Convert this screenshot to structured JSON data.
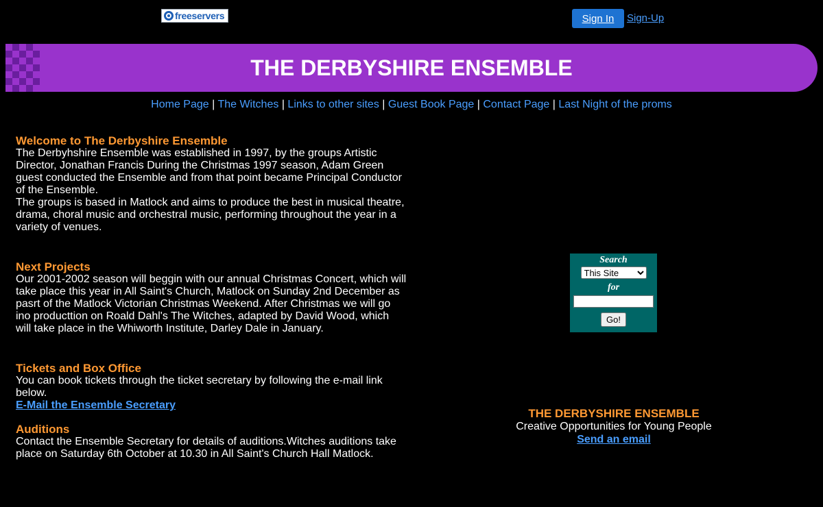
{
  "header": {
    "logo_text": "freeservers",
    "signin_label": "Sign In",
    "signup_label": "Sign-Up"
  },
  "banner": {
    "title": "THE DERBYSHIRE ENSEMBLE"
  },
  "nav": {
    "items": [
      "Home Page",
      "The Witches",
      "Links to other sites",
      "Guest Book Page",
      "Contact Page",
      "Last Night of the proms"
    ],
    "separator": "|"
  },
  "sections": {
    "welcome": {
      "heading": "Welcome to The Derbyshire Ensemble",
      "para1": "The Derbyhshire Ensemble was established in 1997, by the groups Artistic Director, Jonathan Francis During the Christmas 1997 season, Adam Green guest conducted the Ensemble and from that point became Principal Conductor of the Ensemble.",
      "para2": "The groups is based in Matlock and aims to produce the best in musical theatre, drama, choral music and orchestral music, performing throughout the year in a variety of venues."
    },
    "next_projects": {
      "heading": "Next Projects",
      "para": "Our 2001-2002 season will beggin with our annual Christmas Concert, which will take place this year in All Saint's Church, Matlock on Sunday 2nd December as pasrt of the Matlock Victorian Christmas Weekend. After Christmas we will go ino producttion on Roald Dahl's The Witches, adapted by David Wood, which will take place in the Whiworth Institute, Darley Dale in January."
    },
    "tickets": {
      "heading": "Tickets and Box Office",
      "para": "You can book tickets through the ticket secretary by following the e-mail link below.",
      "link": "E-Mail the Ensemble Secretary"
    },
    "auditions": {
      "heading": "Auditions",
      "para": "Contact the Ensemble Secretary for details of auditions.Witches auditions take place on Saturday 6th October at 10.30 in All Saint's Church Hall Matlock."
    }
  },
  "search": {
    "label": "Search",
    "scope_selected": "This Site",
    "for_label": "for",
    "input_value": "",
    "go_label": "Go!"
  },
  "footer": {
    "title": "THE DERBYSHIRE ENSEMBLE",
    "subtitle": "Creative Opportunities for Young People",
    "email_link": "Send an email"
  },
  "colors": {
    "background": "#000000",
    "banner": "#9933cc",
    "heading": "#ff9933",
    "link": "#4a9eff",
    "search_box": "#006666",
    "signin_button": "#1e73d2"
  }
}
